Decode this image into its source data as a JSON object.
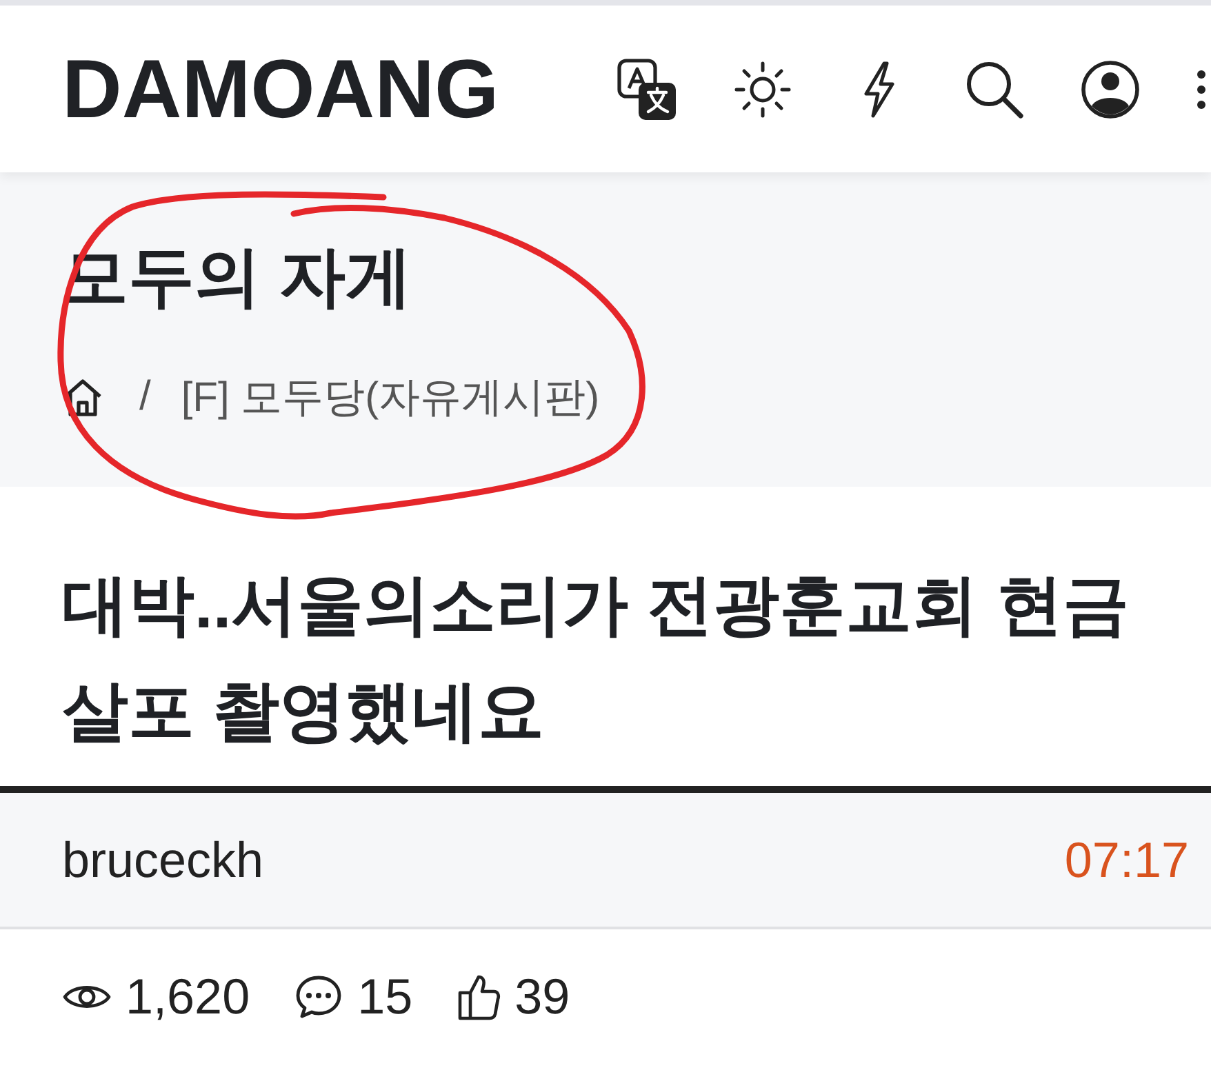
{
  "header": {
    "logo": "DAMOANG"
  },
  "board": {
    "title": "모두의 자게",
    "separator": "/",
    "breadcrumb": [
      {
        "kind": "home"
      },
      {
        "kind": "link",
        "label": "[F] 모두당(자유게시판)"
      }
    ]
  },
  "post": {
    "title": "대박..서울의소리가 전광훈교회 현금 살포 촬영했네요",
    "author": "bruceckh",
    "time": "07:17",
    "stats": [
      {
        "kind": "views",
        "value": "1,620"
      },
      {
        "kind": "comments",
        "value": "15"
      },
      {
        "kind": "likes",
        "value": "39"
      }
    ]
  }
}
